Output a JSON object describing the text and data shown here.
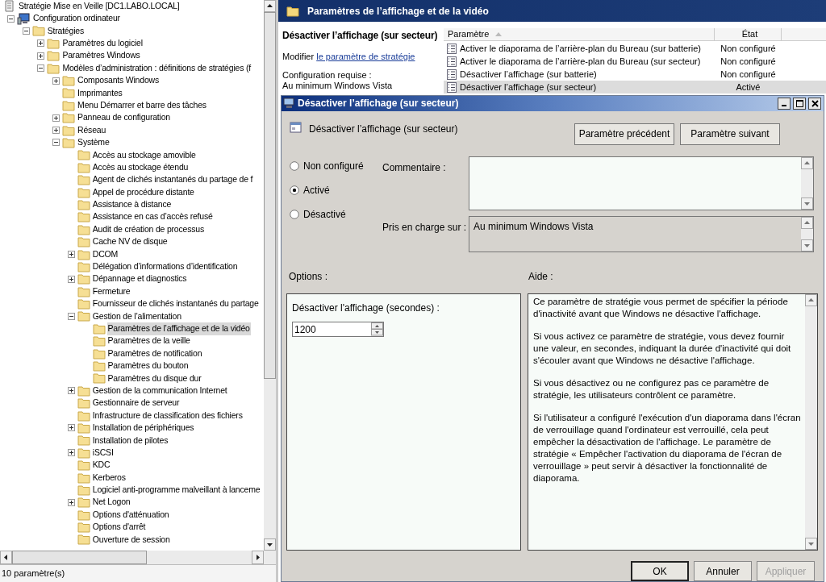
{
  "tree": {
    "items": [
      {
        "label": "Stratégie Mise en Veille [DC1.LABO.LOCAL]",
        "selected": false,
        "children": [
          {
            "label": "Configuration ordinateur",
            "selected": false,
            "expanded": true,
            "children": [
              {
                "label": "Stratégies",
                "selected": false,
                "expanded": true,
                "children": [
                  {
                    "label": "Paramètres du logiciel",
                    "selected": false,
                    "expanded": false
                  },
                  {
                    "label": "Paramètres Windows",
                    "selected": false,
                    "expanded": false
                  },
                  {
                    "label": "Modèles d’administration : définitions de stratégies (f",
                    "selected": false,
                    "expanded": true,
                    "children": [
                      {
                        "label": "Composants Windows",
                        "selected": false,
                        "expanded": false
                      },
                      {
                        "label": "Imprimantes",
                        "selected": false
                      },
                      {
                        "label": "Menu Démarrer et barre des tâches",
                        "selected": false
                      },
                      {
                        "label": "Panneau de configuration",
                        "selected": false,
                        "expanded": false
                      },
                      {
                        "label": "Réseau",
                        "selected": false,
                        "expanded": false
                      },
                      {
                        "label": "Système",
                        "selected": false,
                        "expanded": true,
                        "children": [
                          {
                            "label": "Accès au stockage amovible",
                            "selected": false
                          },
                          {
                            "label": "Accès au stockage étendu",
                            "selected": false
                          },
                          {
                            "label": "Agent de clichés instantanés du partage de f",
                            "selected": false
                          },
                          {
                            "label": "Appel de procédure distante",
                            "selected": false
                          },
                          {
                            "label": "Assistance à distance",
                            "selected": false
                          },
                          {
                            "label": "Assistance en cas d’accès refusé",
                            "selected": false
                          },
                          {
                            "label": "Audit de création de processus",
                            "selected": false
                          },
                          {
                            "label": "Cache NV de disque",
                            "selected": false
                          },
                          {
                            "label": "DCOM",
                            "selected": false,
                            "expanded": false
                          },
                          {
                            "label": "Délégation d’informations d’identification",
                            "selected": false
                          },
                          {
                            "label": "Dépannage et diagnostics",
                            "selected": false,
                            "expanded": false
                          },
                          {
                            "label": "Fermeture",
                            "selected": false
                          },
                          {
                            "label": "Fournisseur de clichés instantanés du partage",
                            "selected": false
                          },
                          {
                            "label": "Gestion de l’alimentation",
                            "selected": false,
                            "expanded": true,
                            "children": [
                              {
                                "label": "Paramètres de l’affichage et de la vidéo",
                                "selected": true
                              },
                              {
                                "label": "Paramètres de la veille",
                                "selected": false
                              },
                              {
                                "label": "Paramètres de notification",
                                "selected": false
                              },
                              {
                                "label": "Paramètres du bouton",
                                "selected": false
                              },
                              {
                                "label": "Paramètres du disque dur",
                                "selected": false
                              }
                            ]
                          },
                          {
                            "label": "Gestion de la communication Internet",
                            "selected": false,
                            "expanded": false
                          },
                          {
                            "label": "Gestionnaire de serveur",
                            "selected": false
                          },
                          {
                            "label": "Infrastructure de classification des fichiers",
                            "selected": false
                          },
                          {
                            "label": "Installation de périphériques",
                            "selected": false,
                            "expanded": false
                          },
                          {
                            "label": "Installation de pilotes",
                            "selected": false
                          },
                          {
                            "label": "iSCSI",
                            "selected": false,
                            "expanded": false
                          },
                          {
                            "label": "KDC",
                            "selected": false
                          },
                          {
                            "label": "Kerberos",
                            "selected": false
                          },
                          {
                            "label": "Logiciel anti-programme malveillant à lanceme",
                            "selected": false
                          },
                          {
                            "label": "Net Logon",
                            "selected": false,
                            "expanded": false
                          },
                          {
                            "label": "Options d'atténuation",
                            "selected": false
                          },
                          {
                            "label": "Options d'arrêt",
                            "selected": false
                          },
                          {
                            "label": "Ouverture de session",
                            "selected": false
                          }
                        ]
                      }
                    ]
                  }
                ]
              }
            ]
          }
        ]
      }
    ]
  },
  "status_bar": "10 paramètre(s)",
  "details": {
    "header_title": "Paramètres de l’affichage et de la vidéo",
    "setting_title": "Désactiver l’affichage (sur secteur)",
    "edit_prefix": "Modifier",
    "edit_link": "le paramètre de stratégie",
    "requirements_label": "Configuration requise :",
    "requirements_value": "Au minimum Windows Vista"
  },
  "table": {
    "columns": [
      {
        "label": "Paramètre",
        "sorted": true
      },
      {
        "label": "État",
        "sorted": false
      }
    ],
    "rows": [
      {
        "name": "Activer le diaporama de l’arrière-plan du Bureau (sur batterie)",
        "state": "Non configuré",
        "selected": false
      },
      {
        "name": "Activer le diaporama de l’arrière-plan du Bureau (sur secteur)",
        "state": "Non configuré",
        "selected": false
      },
      {
        "name": "Désactiver l’affichage (sur batterie)",
        "state": "Non configuré",
        "selected": false
      },
      {
        "name": "Désactiver l’affichage (sur secteur)",
        "state": "Activé",
        "selected": true
      }
    ]
  },
  "dialog": {
    "title": "Désactiver l’affichage (sur secteur)",
    "setting_name": "Désactiver l’affichage (sur secteur)",
    "nav_buttons": [
      "Paramètre précédent",
      "Paramètre suivant"
    ],
    "radios": [
      {
        "label": "Non configuré",
        "selected": false
      },
      {
        "label": "Activé",
        "selected": true
      },
      {
        "label": "Désactivé",
        "selected": false
      }
    ],
    "comment_label": "Commentaire :",
    "supported_label": "Pris en charge sur :",
    "supported_value": "Au minimum Windows Vista",
    "options_label": "Options :",
    "help_label": "Aide :",
    "option_field_label": "Désactiver l'affichage (secondes) :",
    "option_value": "1200",
    "help_paragraphs": [
      "Ce paramètre de stratégie vous permet de spécifier la période d'inactivité avant que Windows ne désactive l'affichage.",
      "Si vous activez ce paramètre de stratégie, vous devez fournir une valeur, en secondes, indiquant la durée d'inactivité qui doit s'écouler avant que Windows ne désactive l'affichage.",
      "Si vous désactivez ou ne configurez pas ce paramètre de stratégie, les utilisateurs contrôlent ce paramètre.",
      "Si l'utilisateur a configuré l'exécution d'un diaporama dans l'écran de verrouillage quand l'ordinateur est verrouillé, cela peut empêcher la désactivation de l'affichage.  Le paramètre de stratégie « Empêcher l'activation du diaporama de l'écran de verrouillage » peut servir à désactiver la fonctionnalité de diaporama."
    ],
    "buttons": [
      {
        "label": "OK",
        "kind": "default",
        "disabled": false
      },
      {
        "label": "Annuler",
        "kind": "normal",
        "disabled": false
      },
      {
        "label": "Appliquer",
        "kind": "normal",
        "disabled": true
      }
    ]
  }
}
